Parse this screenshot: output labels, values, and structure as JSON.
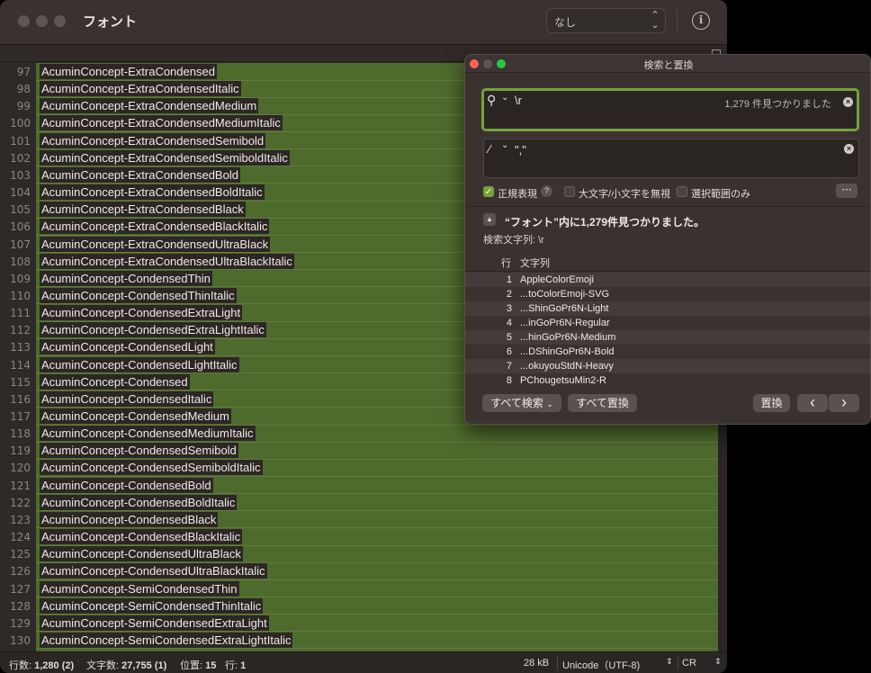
{
  "window": {
    "title": "フォント",
    "syntax_popup": "なし"
  },
  "lines": [
    {
      "n": "97",
      "text": "AcuminConcept-ExtraCondensed"
    },
    {
      "n": "98",
      "text": "AcuminConcept-ExtraCondensedItalic"
    },
    {
      "n": "99",
      "text": "AcuminConcept-ExtraCondensedMedium"
    },
    {
      "n": "100",
      "text": "AcuminConcept-ExtraCondensedMediumItalic"
    },
    {
      "n": "101",
      "text": "AcuminConcept-ExtraCondensedSemibold"
    },
    {
      "n": "102",
      "text": "AcuminConcept-ExtraCondensedSemiboldItalic"
    },
    {
      "n": "103",
      "text": "AcuminConcept-ExtraCondensedBold"
    },
    {
      "n": "104",
      "text": "AcuminConcept-ExtraCondensedBoldItalic"
    },
    {
      "n": "105",
      "text": "AcuminConcept-ExtraCondensedBlack"
    },
    {
      "n": "106",
      "text": "AcuminConcept-ExtraCondensedBlackItalic"
    },
    {
      "n": "107",
      "text": "AcuminConcept-ExtraCondensedUltraBlack"
    },
    {
      "n": "108",
      "text": "AcuminConcept-ExtraCondensedUltraBlackItalic"
    },
    {
      "n": "109",
      "text": "AcuminConcept-CondensedThin"
    },
    {
      "n": "110",
      "text": "AcuminConcept-CondensedThinItalic"
    },
    {
      "n": "111",
      "text": "AcuminConcept-CondensedExtraLight"
    },
    {
      "n": "112",
      "text": "AcuminConcept-CondensedExtraLightItalic"
    },
    {
      "n": "113",
      "text": "AcuminConcept-CondensedLight"
    },
    {
      "n": "114",
      "text": "AcuminConcept-CondensedLightItalic"
    },
    {
      "n": "115",
      "text": "AcuminConcept-Condensed"
    },
    {
      "n": "116",
      "text": "AcuminConcept-CondensedItalic"
    },
    {
      "n": "117",
      "text": "AcuminConcept-CondensedMedium"
    },
    {
      "n": "118",
      "text": "AcuminConcept-CondensedMediumItalic"
    },
    {
      "n": "119",
      "text": "AcuminConcept-CondensedSemibold"
    },
    {
      "n": "120",
      "text": "AcuminConcept-CondensedSemiboldItalic"
    },
    {
      "n": "121",
      "text": "AcuminConcept-CondensedBold"
    },
    {
      "n": "122",
      "text": "AcuminConcept-CondensedBoldItalic"
    },
    {
      "n": "123",
      "text": "AcuminConcept-CondensedBlack"
    },
    {
      "n": "124",
      "text": "AcuminConcept-CondensedBlackItalic"
    },
    {
      "n": "125",
      "text": "AcuminConcept-CondensedUltraBlack"
    },
    {
      "n": "126",
      "text": "AcuminConcept-CondensedUltraBlackItalic"
    },
    {
      "n": "127",
      "text": "AcuminConcept-SemiCondensedThin"
    },
    {
      "n": "128",
      "text": "AcuminConcept-SemiCondensedThinItalic"
    },
    {
      "n": "129",
      "text": "AcuminConcept-SemiCondensedExtraLight"
    },
    {
      "n": "130",
      "text": "AcuminConcept-SemiCondensedExtraLightItalic"
    }
  ],
  "status": {
    "lines_label": "行数:",
    "lines_value": "1,280 (2)",
    "chars_label": "文字数:",
    "chars_value": "27,755 (1)",
    "pos_label": "位置:",
    "pos_value": "15",
    "row_label": "行:",
    "row_value": "1",
    "size": "28 kB",
    "encoding": "Unicode（UTF-8)",
    "line_ending": "CR"
  },
  "find_panel": {
    "title": "検索と置換",
    "find_value": "\\r",
    "find_count": "1,279 件見つかりました",
    "replace_value": "\",\"",
    "regex_label": "正規表現",
    "regex_help": "?",
    "ignore_case_label": "大文字/小文字を無視",
    "selection_only_label": "選択範囲のみ",
    "summary": "“フォント”内に1,279件見つかりました。",
    "search_string_label": "検索文字列: \\r",
    "col_line": "行",
    "col_string": "文字列",
    "results": [
      {
        "n": "1",
        "s": "AppleColorEmoji"
      },
      {
        "n": "2",
        "s": "...toColorEmoji-SVG"
      },
      {
        "n": "3",
        "s": "...ShinGoPr6N-Light"
      },
      {
        "n": "4",
        "s": "...inGoPr6N-Regular"
      },
      {
        "n": "5",
        "s": "...hinGoPr6N-Medium"
      },
      {
        "n": "6",
        "s": "...DShinGoPr6N-Bold"
      },
      {
        "n": "7",
        "s": "...okuyouStdN-Heavy"
      },
      {
        "n": "8",
        "s": "PChougetsuMin2-R"
      }
    ],
    "find_all_label": "すべて検索",
    "replace_all_label": "すべて置換",
    "replace_label": "置換",
    "prev_label": "‹",
    "next_label": "›"
  }
}
